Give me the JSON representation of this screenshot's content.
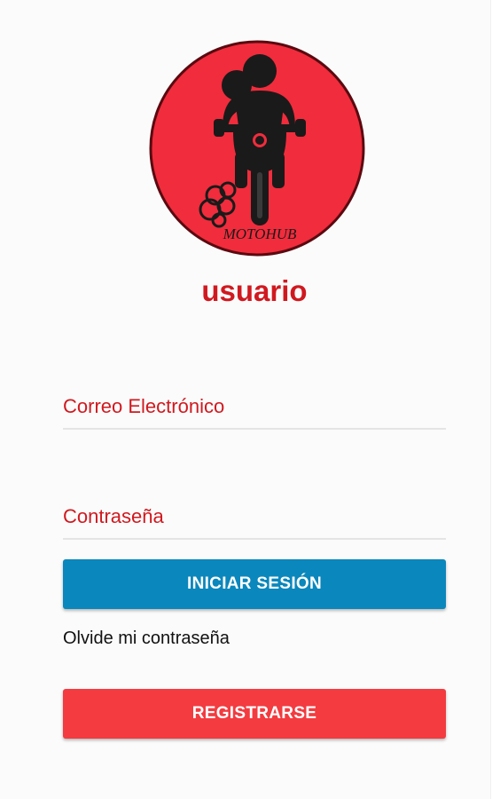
{
  "logo": {
    "brand_text": "MOTOHUB",
    "circle_color": "#f12c3c",
    "icon": "motorcycle-riders-logo"
  },
  "page": {
    "title": "usuario"
  },
  "form": {
    "email_placeholder": "Correo Electrónico",
    "email_value": "",
    "password_placeholder": "Contraseña",
    "password_value": "",
    "login_label": "INICIAR SESIÓN",
    "forgot_label": "Olvide mi contraseña",
    "register_label": "REGISTRARSE"
  },
  "colors": {
    "accent_red": "#d0191f",
    "login_button": "#0a87bc",
    "register_button": "#f33b40"
  }
}
